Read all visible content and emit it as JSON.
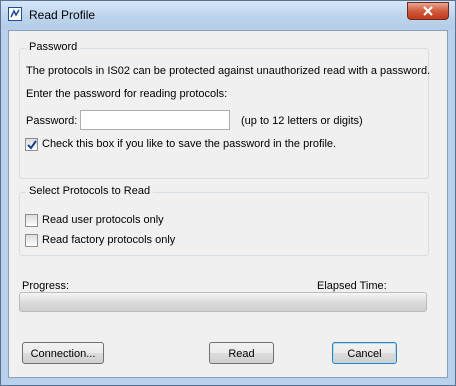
{
  "window": {
    "title": "Read Profile",
    "icon": "app-icon",
    "close_icon": "close-icon"
  },
  "password_group": {
    "title": "Password",
    "info": "The protocols in IS02 can be protected against unauthorized read with a password.",
    "prompt": "Enter the password for reading protocols:",
    "password_label": "Password:",
    "password_value": "",
    "password_hint": "(up to 12 letters or digits)",
    "save_checkbox_label": "Check this box if you like to save the password in the profile.",
    "save_checked": true
  },
  "protocols_group": {
    "title": "Select Protocols to Read",
    "user_only_label": "Read user protocols only",
    "user_only_checked": false,
    "factory_only_label": "Read factory protocols only",
    "factory_only_checked": false
  },
  "progress": {
    "label": "Progress:",
    "elapsed_label": "Elapsed Time:",
    "value": 0
  },
  "buttons": {
    "connection": "Connection...",
    "read": "Read",
    "cancel": "Cancel"
  }
}
